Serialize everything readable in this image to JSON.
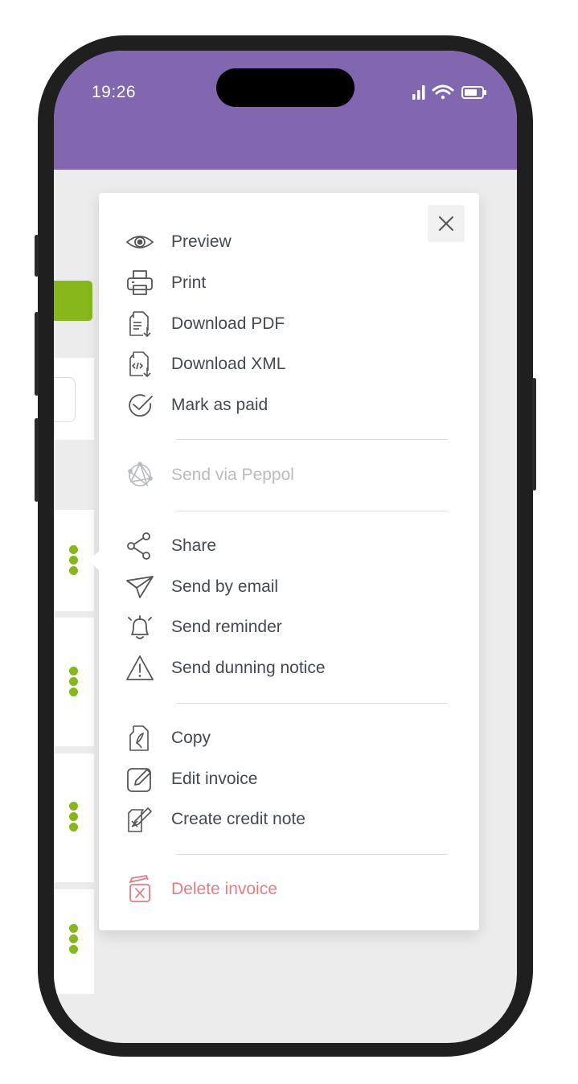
{
  "status_bar": {
    "time": "19:26",
    "background": "#8067b0"
  },
  "accent_green": "#86b81c",
  "menu": {
    "close_icon": "close-icon",
    "groups": [
      [
        {
          "label": "Preview",
          "icon": "eye-icon"
        },
        {
          "label": "Print",
          "icon": "printer-icon"
        },
        {
          "label": "Download PDF",
          "icon": "download-pdf-icon"
        },
        {
          "label": "Download XML",
          "icon": "download-xml-icon"
        },
        {
          "label": "Mark as paid",
          "icon": "check-circle-icon"
        }
      ],
      [
        {
          "label": "Send via Peppol",
          "icon": "peppol-network-icon",
          "disabled": true
        }
      ],
      [
        {
          "label": "Share",
          "icon": "share-icon"
        },
        {
          "label": "Send by email",
          "icon": "paper-plane-icon"
        },
        {
          "label": "Send reminder",
          "icon": "bell-icon"
        },
        {
          "label": "Send dunning notice",
          "icon": "warning-triangle-icon"
        }
      ],
      [
        {
          "label": "Copy",
          "icon": "copy-document-icon"
        },
        {
          "label": "Edit invoice",
          "icon": "edit-pencil-icon"
        },
        {
          "label": "Create credit note",
          "icon": "credit-note-icon"
        }
      ],
      [
        {
          "label": "Delete invoice",
          "icon": "delete-trash-icon",
          "danger": true
        }
      ]
    ]
  }
}
